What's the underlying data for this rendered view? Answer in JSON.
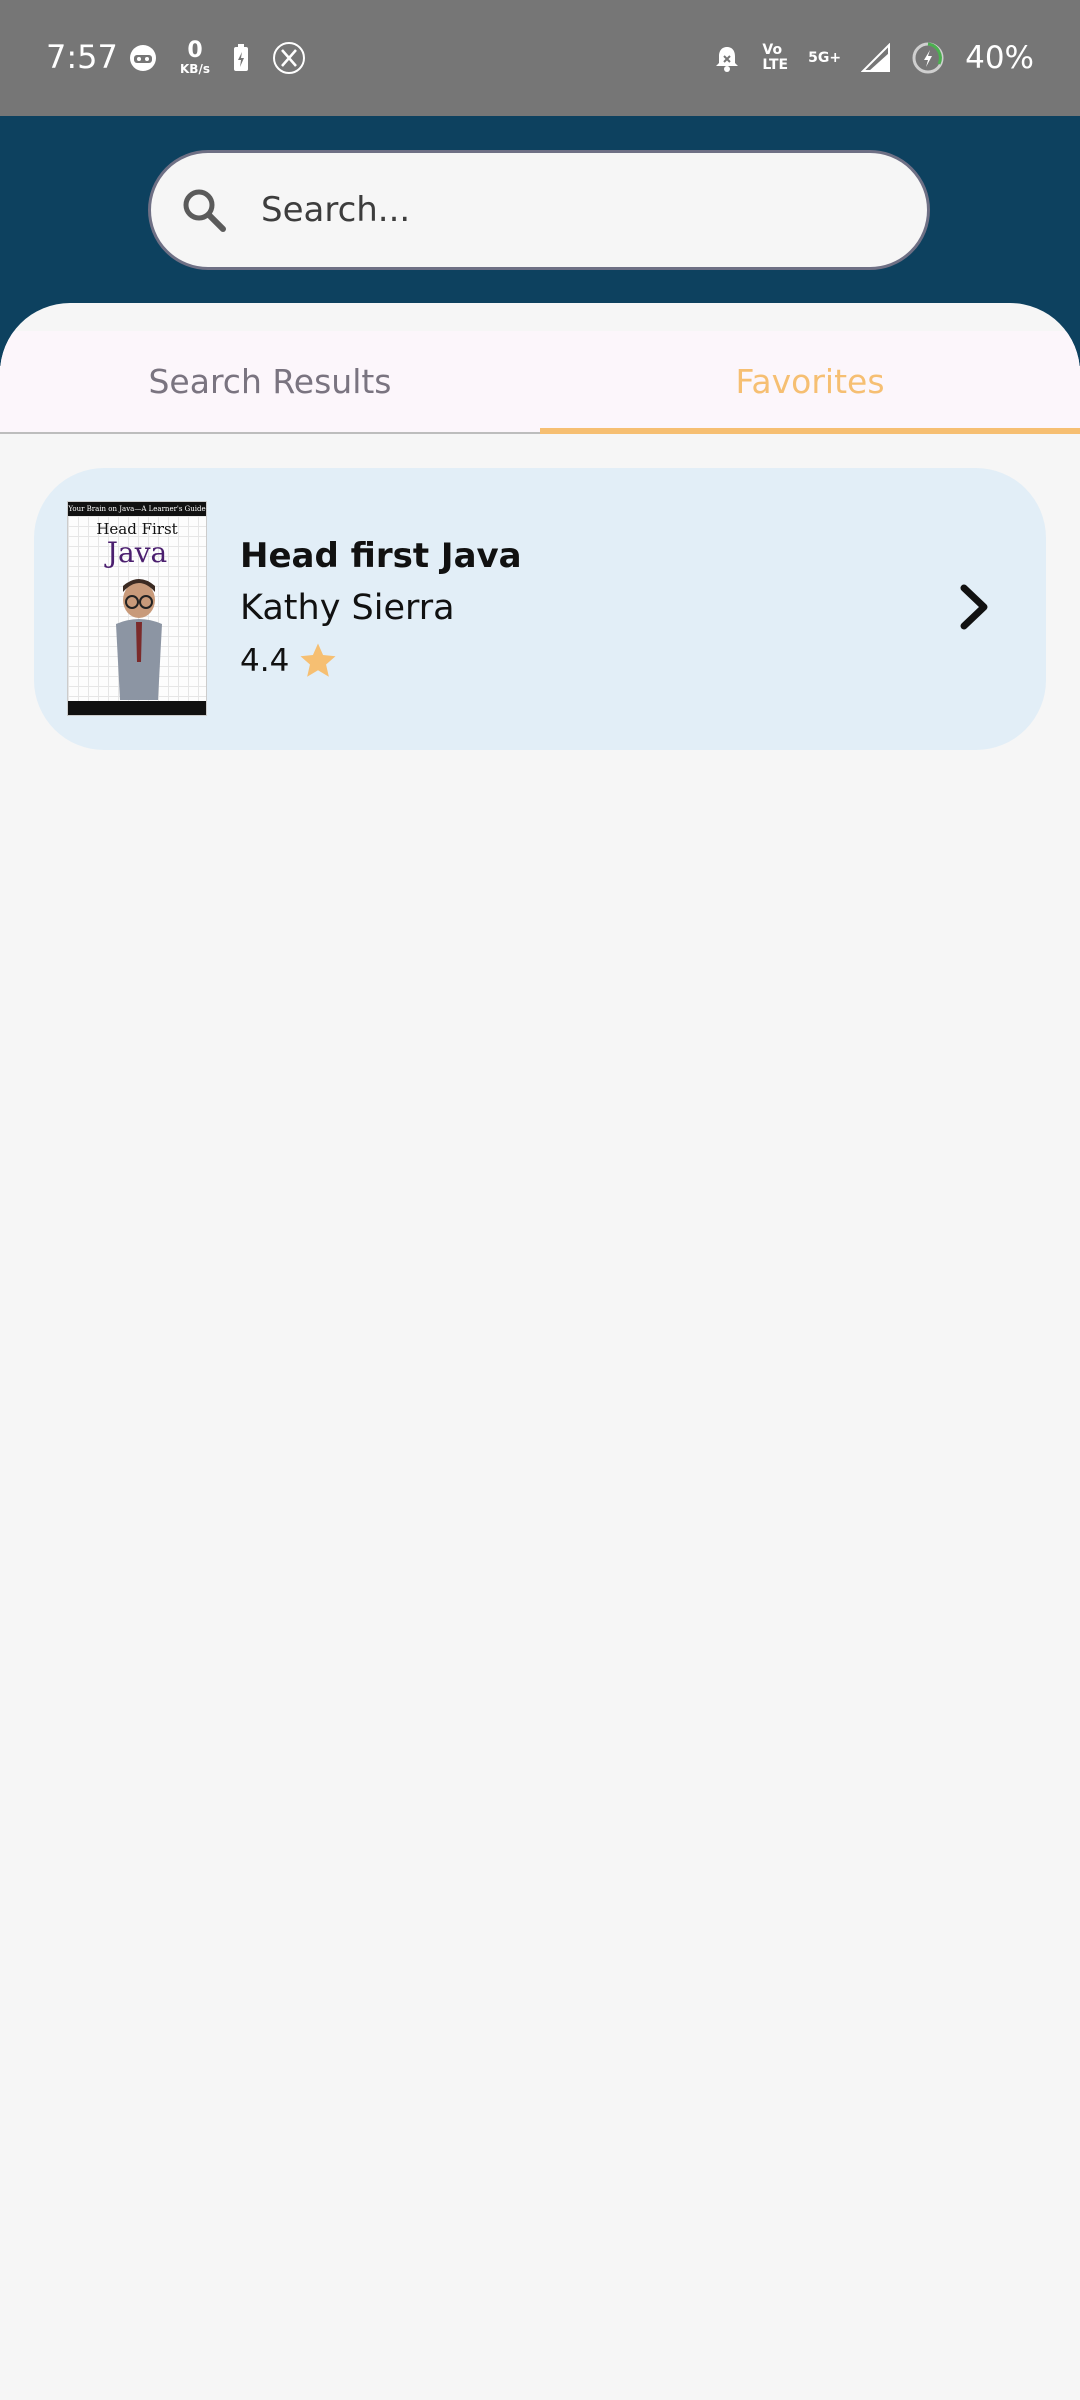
{
  "status_bar": {
    "time": "7:57",
    "net_speed_value": "0",
    "net_speed_unit": "KB/s",
    "volte_top": "Vo",
    "volte_bottom": "LTE",
    "network_type": "5G+",
    "battery_percent": "40%",
    "icons": [
      "face-icon",
      "battery-saver-icon",
      "x-app-icon",
      "alarm-icon",
      "volte-icon",
      "signal-icon",
      "battery-charging-icon"
    ]
  },
  "search": {
    "placeholder": "Search...",
    "icon": "search-icon"
  },
  "tabs": [
    {
      "label": "Search Results",
      "active": false
    },
    {
      "label": "Favorites",
      "active": true
    }
  ],
  "colors": {
    "header": "#0d415f",
    "accent": "#f6bf72",
    "card": "#e2eef7",
    "status_bar": "#767676"
  },
  "favorites": [
    {
      "title": "Head first Java",
      "author": "Kathy Sierra",
      "rating": "4.4",
      "cover": {
        "top_text": "Your Brain on Java—A Learner's Guide",
        "head_first": "Head First",
        "java": "Java"
      }
    }
  ]
}
